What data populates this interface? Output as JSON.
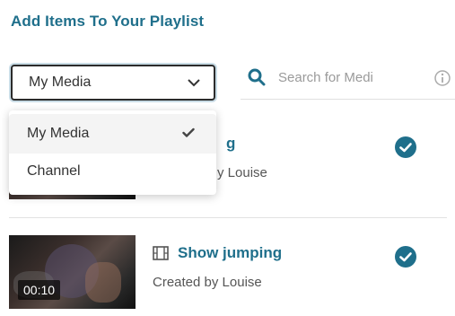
{
  "panel": {
    "title": "Add Items To Your Playlist"
  },
  "source_select": {
    "selected": "My Media",
    "options": [
      "My Media",
      "Channel"
    ]
  },
  "search": {
    "placeholder": "Search for Medi"
  },
  "items": [
    {
      "title_fragment": "g",
      "created_by_fragment": "y Louise",
      "selected": true
    },
    {
      "title": "Show jumping",
      "created_by": "Created by Louise",
      "duration": "00:10",
      "selected": true
    }
  ],
  "colors": {
    "accent": "#1f6f8b",
    "check_fill": "#1f6f8b"
  },
  "icons": {
    "select": "chevron-down-icon",
    "search": "search-icon",
    "info": "info-icon",
    "media_type": "film-icon",
    "item_selected": "check-circle-icon",
    "option_selected": "checkmark-icon"
  }
}
